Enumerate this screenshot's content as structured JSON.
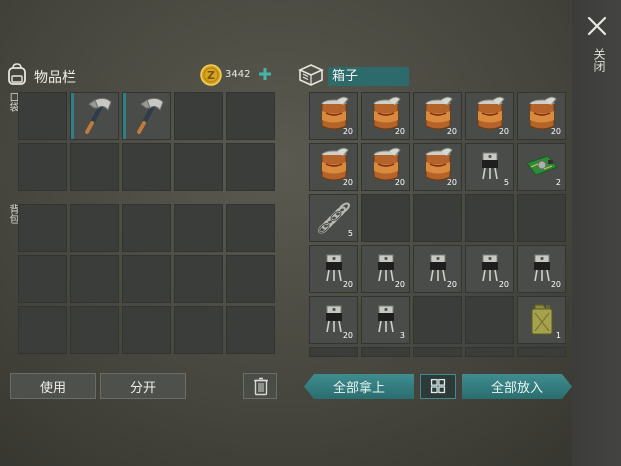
{
  "close": {
    "label": "关闭"
  },
  "inventory": {
    "title": "物品栏",
    "coins": "3442",
    "pocket_label": "口袋",
    "backpack_label": "背包",
    "pocket_slots": [
      {
        "item": "",
        "count": ""
      },
      {
        "item": "hatchet",
        "count": ""
      },
      {
        "item": "hatchet",
        "count": ""
      },
      {
        "item": "",
        "count": ""
      },
      {
        "item": "",
        "count": ""
      },
      {
        "item": "",
        "count": ""
      },
      {
        "item": "",
        "count": ""
      },
      {
        "item": "",
        "count": ""
      },
      {
        "item": "",
        "count": ""
      },
      {
        "item": "",
        "count": ""
      }
    ],
    "backpack_slots": [
      {
        "item": "",
        "count": ""
      },
      {
        "item": "",
        "count": ""
      },
      {
        "item": "",
        "count": ""
      },
      {
        "item": "",
        "count": ""
      },
      {
        "item": "",
        "count": ""
      },
      {
        "item": "",
        "count": ""
      },
      {
        "item": "",
        "count": ""
      },
      {
        "item": "",
        "count": ""
      },
      {
        "item": "",
        "count": ""
      },
      {
        "item": "",
        "count": ""
      },
      {
        "item": "",
        "count": ""
      },
      {
        "item": "",
        "count": ""
      },
      {
        "item": "",
        "count": ""
      },
      {
        "item": "",
        "count": ""
      },
      {
        "item": "",
        "count": ""
      }
    ],
    "use_label": "使用",
    "split_label": "分开"
  },
  "box": {
    "title": "箱子",
    "slots": [
      {
        "item": "canned-food",
        "count": "20"
      },
      {
        "item": "canned-food",
        "count": "20"
      },
      {
        "item": "canned-food",
        "count": "20"
      },
      {
        "item": "canned-food",
        "count": "20"
      },
      {
        "item": "canned-food",
        "count": "20"
      },
      {
        "item": "canned-food",
        "count": "20"
      },
      {
        "item": "canned-food",
        "count": "20"
      },
      {
        "item": "canned-food",
        "count": "20"
      },
      {
        "item": "transistor",
        "count": "5"
      },
      {
        "item": "circuit-board",
        "count": "2"
      },
      {
        "item": "spring",
        "count": "5"
      },
      {
        "item": "",
        "count": ""
      },
      {
        "item": "",
        "count": ""
      },
      {
        "item": "",
        "count": ""
      },
      {
        "item": "",
        "count": ""
      },
      {
        "item": "transistor",
        "count": "20"
      },
      {
        "item": "transistor",
        "count": "20"
      },
      {
        "item": "transistor",
        "count": "20"
      },
      {
        "item": "transistor",
        "count": "20"
      },
      {
        "item": "transistor",
        "count": "20"
      },
      {
        "item": "transistor",
        "count": "20"
      },
      {
        "item": "transistor",
        "count": "3"
      },
      {
        "item": "",
        "count": ""
      },
      {
        "item": "",
        "count": ""
      },
      {
        "item": "jerry-can",
        "count": "1"
      }
    ],
    "take_all_label": "全部拿上",
    "put_all_label": "全部放入"
  },
  "colors": {
    "accent_teal": "#2f7f84",
    "button_teal": "#3f8c8e"
  }
}
